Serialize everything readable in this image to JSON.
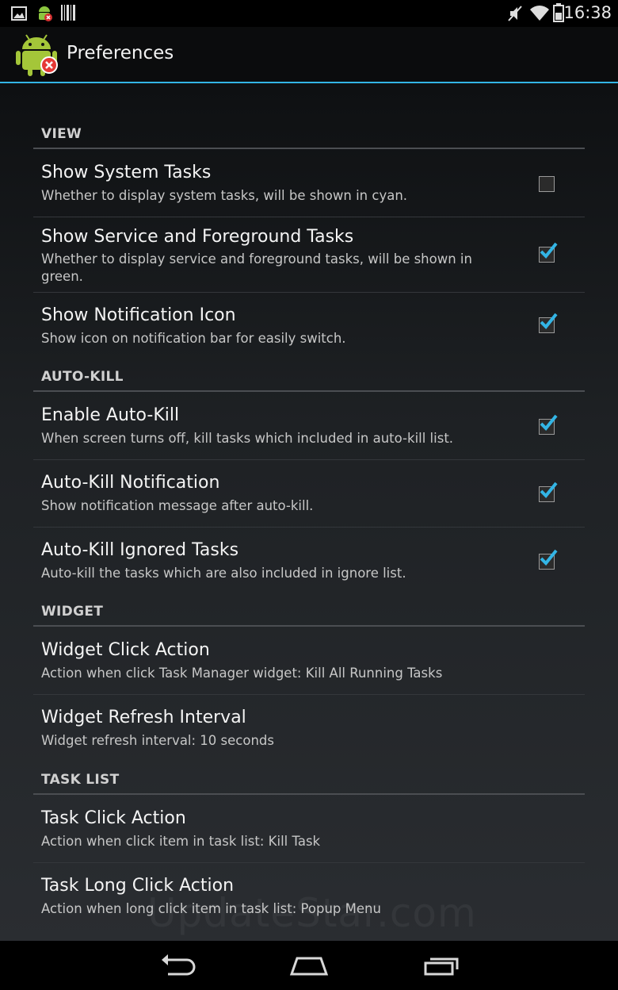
{
  "status_bar": {
    "time": "16:38",
    "left_icons": [
      "image-icon",
      "android-notification-icon",
      "barcode-icon"
    ],
    "right_icons": [
      "mute-icon",
      "wifi-icon",
      "battery-icon"
    ]
  },
  "action_bar": {
    "app_icon": "android-robot-icon",
    "title": "Preferences",
    "accent_color": "#33b5e5"
  },
  "sections": {
    "view": {
      "title": "VIEW",
      "items": [
        {
          "title": "Show System Tasks",
          "summary": "Whether to display system tasks, will be shown in cyan.",
          "checked": false
        },
        {
          "title": "Show Service and Foreground Tasks",
          "summary": "Whether to display service and foreground tasks, will be shown in green.",
          "checked": true
        },
        {
          "title": "Show Notification Icon",
          "summary": "Show icon on notification bar for easily switch.",
          "checked": true
        }
      ]
    },
    "auto_kill": {
      "title": "AUTO-KILL",
      "items": [
        {
          "title": "Enable Auto-Kill",
          "summary": "When screen turns off, kill tasks which included in auto-kill list.",
          "checked": true
        },
        {
          "title": "Auto-Kill Notification",
          "summary": "Show notification message after auto-kill.",
          "checked": true
        },
        {
          "title": "Auto-Kill Ignored Tasks",
          "summary": "Auto-kill the tasks which are also included in ignore list.",
          "checked": true
        }
      ]
    },
    "widget": {
      "title": "WIDGET",
      "items": [
        {
          "title": "Widget Click Action",
          "summary": "Action when click Task Manager widget: Kill All Running Tasks"
        },
        {
          "title": "Widget Refresh Interval",
          "summary": "Widget refresh interval: 10 seconds"
        }
      ]
    },
    "task_list": {
      "title": "TASK LIST",
      "items": [
        {
          "title": "Task Click Action",
          "summary": "Action when click item in task list: Kill Task"
        },
        {
          "title": "Task Long Click Action",
          "summary": "Action when long click item in task list: Popup Menu"
        }
      ]
    }
  },
  "nav_bar": {
    "buttons": [
      "back-icon",
      "home-icon",
      "recent-apps-icon"
    ]
  },
  "watermark": "UpdateStar.com",
  "colors": {
    "check_color": "#33b5e5",
    "background": "#1c1f22"
  }
}
